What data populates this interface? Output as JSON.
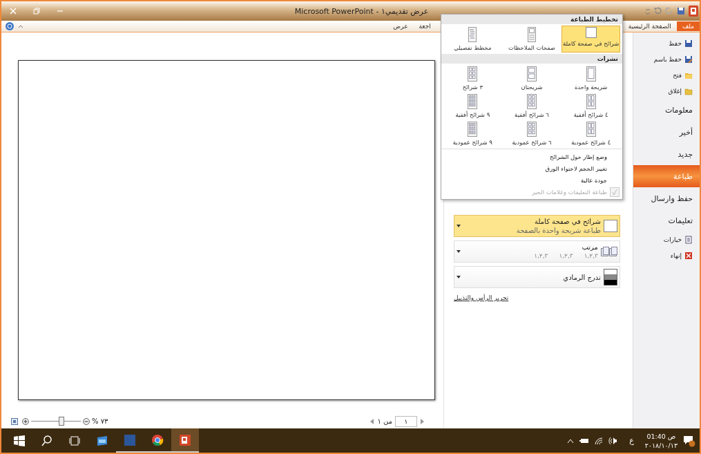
{
  "window": {
    "title": "عرض تقديمي١ - Microsoft PowerPoint"
  },
  "ribbon_tabs": [
    {
      "label": "ملف",
      "selected": true
    },
    {
      "label": "الصفحة الرئيسية",
      "selected": false
    },
    {
      "label": "اجعة",
      "selected": false
    },
    {
      "label": "عرض",
      "selected": false
    }
  ],
  "backstage_nav": [
    {
      "label": "حفظ",
      "kind": "command",
      "selected": false
    },
    {
      "label": "حفظ باسم",
      "kind": "command",
      "selected": false
    },
    {
      "label": "فتح",
      "kind": "command",
      "selected": false
    },
    {
      "label": "إغلاق",
      "kind": "command",
      "selected": false
    },
    {
      "label": "معلومات",
      "kind": "page",
      "selected": false
    },
    {
      "label": "أخير",
      "kind": "page",
      "selected": false
    },
    {
      "label": "جديد",
      "kind": "page",
      "selected": false
    },
    {
      "label": "طباعة",
      "kind": "page",
      "selected": true
    },
    {
      "label": "حفظ  وارسال",
      "kind": "page",
      "selected": false
    },
    {
      "label": "تعليمات",
      "kind": "page",
      "selected": false
    },
    {
      "label": "خيارات",
      "kind": "command",
      "selected": false
    },
    {
      "label": "إنهاء",
      "kind": "command",
      "selected": false
    }
  ],
  "print_layout_menu": {
    "sections": [
      {
        "title": "تخطيط الطباعة",
        "options": [
          {
            "label": "شرائح في صفحة كاملة",
            "selected": true
          },
          {
            "label": "صفحات الملاحظات",
            "selected": false
          },
          {
            "label": "مخطط تفصيلي",
            "selected": false
          }
        ]
      },
      {
        "title": "نشرات",
        "options": [
          {
            "label": "شريحة واحدة",
            "selected": false
          },
          {
            "label": "شريحتان",
            "selected": false
          },
          {
            "label": "٣ شرائح",
            "selected": false
          },
          {
            "label": "٤ شرائح أفقية",
            "selected": false
          },
          {
            "label": "٦ شرائح أفقية",
            "selected": false
          },
          {
            "label": "٩ شرائح أفقية",
            "selected": false
          },
          {
            "label": "٤ شرائح عمودية",
            "selected": false
          },
          {
            "label": "٦ شرائح عمودية",
            "selected": false
          },
          {
            "label": "٩ شرائح عمودية",
            "selected": false
          }
        ]
      }
    ],
    "toggles": [
      {
        "label": "وضع إطار حول الشرائح",
        "checked": false,
        "disabled": false
      },
      {
        "label": "تغيير الحجم لاحتواء الورق",
        "checked": false,
        "disabled": false
      },
      {
        "label": "جودة عالية",
        "checked": false,
        "disabled": false
      },
      {
        "label": "طباعة التعليقات وعلامات الحبر",
        "checked": true,
        "disabled": true
      }
    ]
  },
  "print_settings": [
    {
      "kind": "layout",
      "title": "شرائح في صفحة كاملة",
      "subtitle": "طباعة شريحة واحدة بالصفحة",
      "open": true
    },
    {
      "kind": "collate",
      "title": "مرتب",
      "pages": [
        "١,٢,٣",
        "١,٢,٣",
        "١,٢,٣"
      ],
      "open": false
    },
    {
      "kind": "color",
      "title": "تدرج الرمادي",
      "open": false
    }
  ],
  "header_footer_link": "تحرير الرأس والتذييل",
  "status_bar": {
    "page_number": "١",
    "page_of": "من ١",
    "zoom": "% ٧٣",
    "zoom_slider": {
      "level": 0.6
    }
  },
  "taskbar": {
    "apps": [
      {
        "running": false,
        "selected": false
      },
      {
        "running": true,
        "selected": false
      },
      {
        "running": true,
        "selected": false
      },
      {
        "running": true,
        "selected": true
      }
    ],
    "language": "ع",
    "time": "ص 01:40",
    "date": "٢٠١٨/١٠/١٣"
  }
}
